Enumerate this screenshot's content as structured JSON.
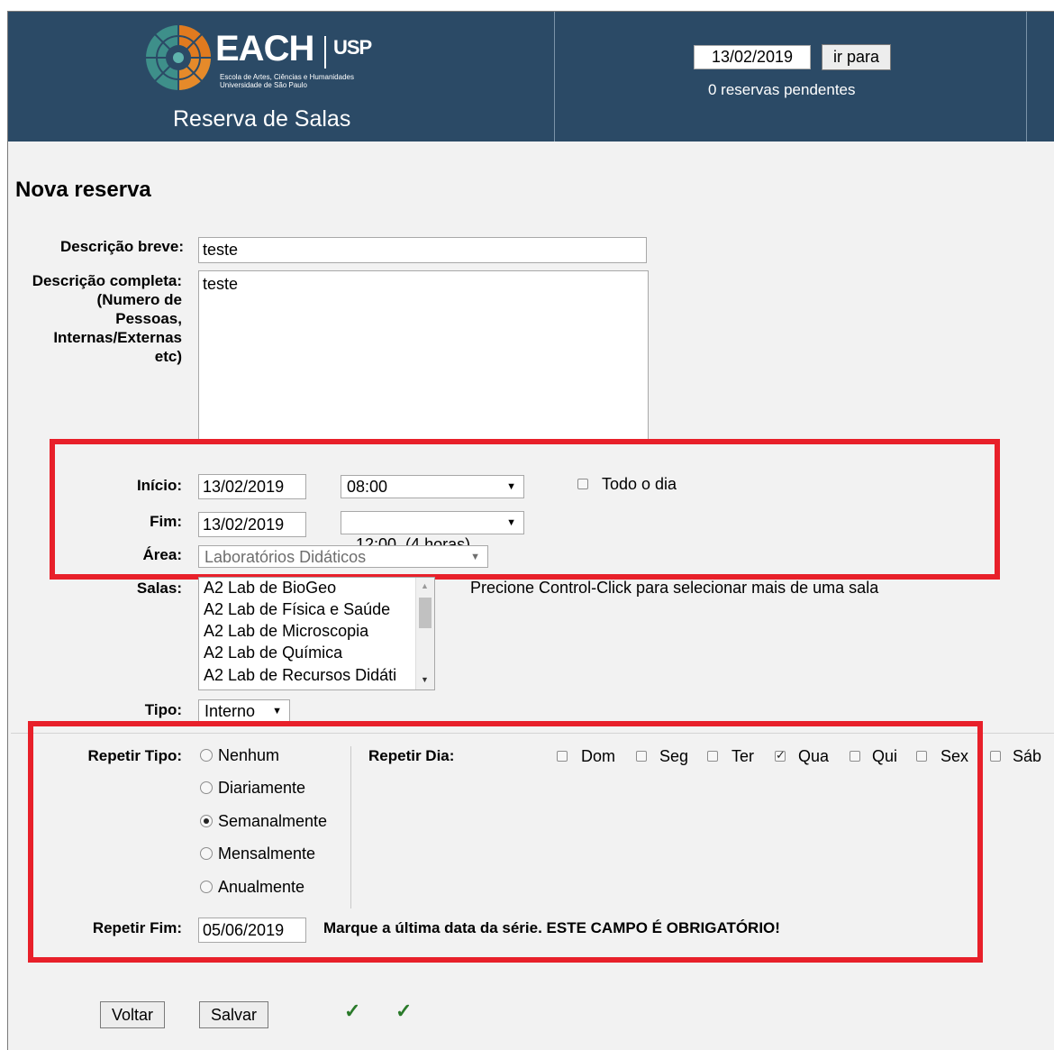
{
  "header": {
    "logo_text": "EACH",
    "logo_usp": "USP",
    "logo_subtitle_1": "Escola de Artes, Ciências e Humanidades",
    "logo_subtitle_2": "Universidade de São Paulo",
    "app_title": "Reserva de Salas",
    "date_value": "13/02/2019",
    "goto_label": "ir para",
    "pending_text": "0 reservas pendentes",
    "bg_color": "#2b4a66"
  },
  "form": {
    "title": "Nova reserva",
    "short_desc": {
      "label": "Descrição breve:",
      "value": "teste"
    },
    "full_desc": {
      "label_lines": [
        "Descrição completa:",
        "(Numero de",
        "Pessoas,",
        "Internas/Externas",
        "etc)"
      ],
      "value": "teste"
    },
    "start": {
      "label": "Início:",
      "date": "13/02/2019",
      "time": "08:00"
    },
    "all_day": {
      "label": "Todo o dia",
      "checked": false
    },
    "end": {
      "label": "Fim:",
      "date": "13/02/2019",
      "time": "12:00  (4 horas)"
    },
    "area": {
      "label": "Área:",
      "value": "Laboratórios Didáticos"
    },
    "rooms": {
      "label": "Salas:",
      "items": [
        "A2 Lab de BioGeo",
        "A2 Lab de Física e Saúde",
        "A2 Lab de Microscopia",
        "A2 Lab de Química",
        "A2 Lab de Recursos Didáti"
      ],
      "hint": "Precione Control-Click para selecionar mais de uma sala"
    },
    "type": {
      "label": "Tipo:",
      "value": "Interno"
    },
    "repeat_type": {
      "label": "Repetir Tipo:",
      "options": [
        "Nenhum",
        "Diariamente",
        "Semanalmente",
        "Mensalmente",
        "Anualmente"
      ],
      "selected": "Semanalmente"
    },
    "repeat_day": {
      "label": "Repetir Dia:",
      "days": [
        "Dom",
        "Seg",
        "Ter",
        "Qua",
        "Qui",
        "Sex",
        "Sáb"
      ],
      "checked": [
        "Qua"
      ]
    },
    "repeat_end": {
      "label": "Repetir Fim:",
      "value": "05/06/2019",
      "note": "Marque a última data da série. ESTE CAMPO É OBRIGATÓRIO!"
    },
    "buttons": {
      "back": "Voltar",
      "save": "Salvar"
    },
    "check_marks": [
      "✓",
      "✓"
    ],
    "highlight_color": "#e8202a"
  }
}
